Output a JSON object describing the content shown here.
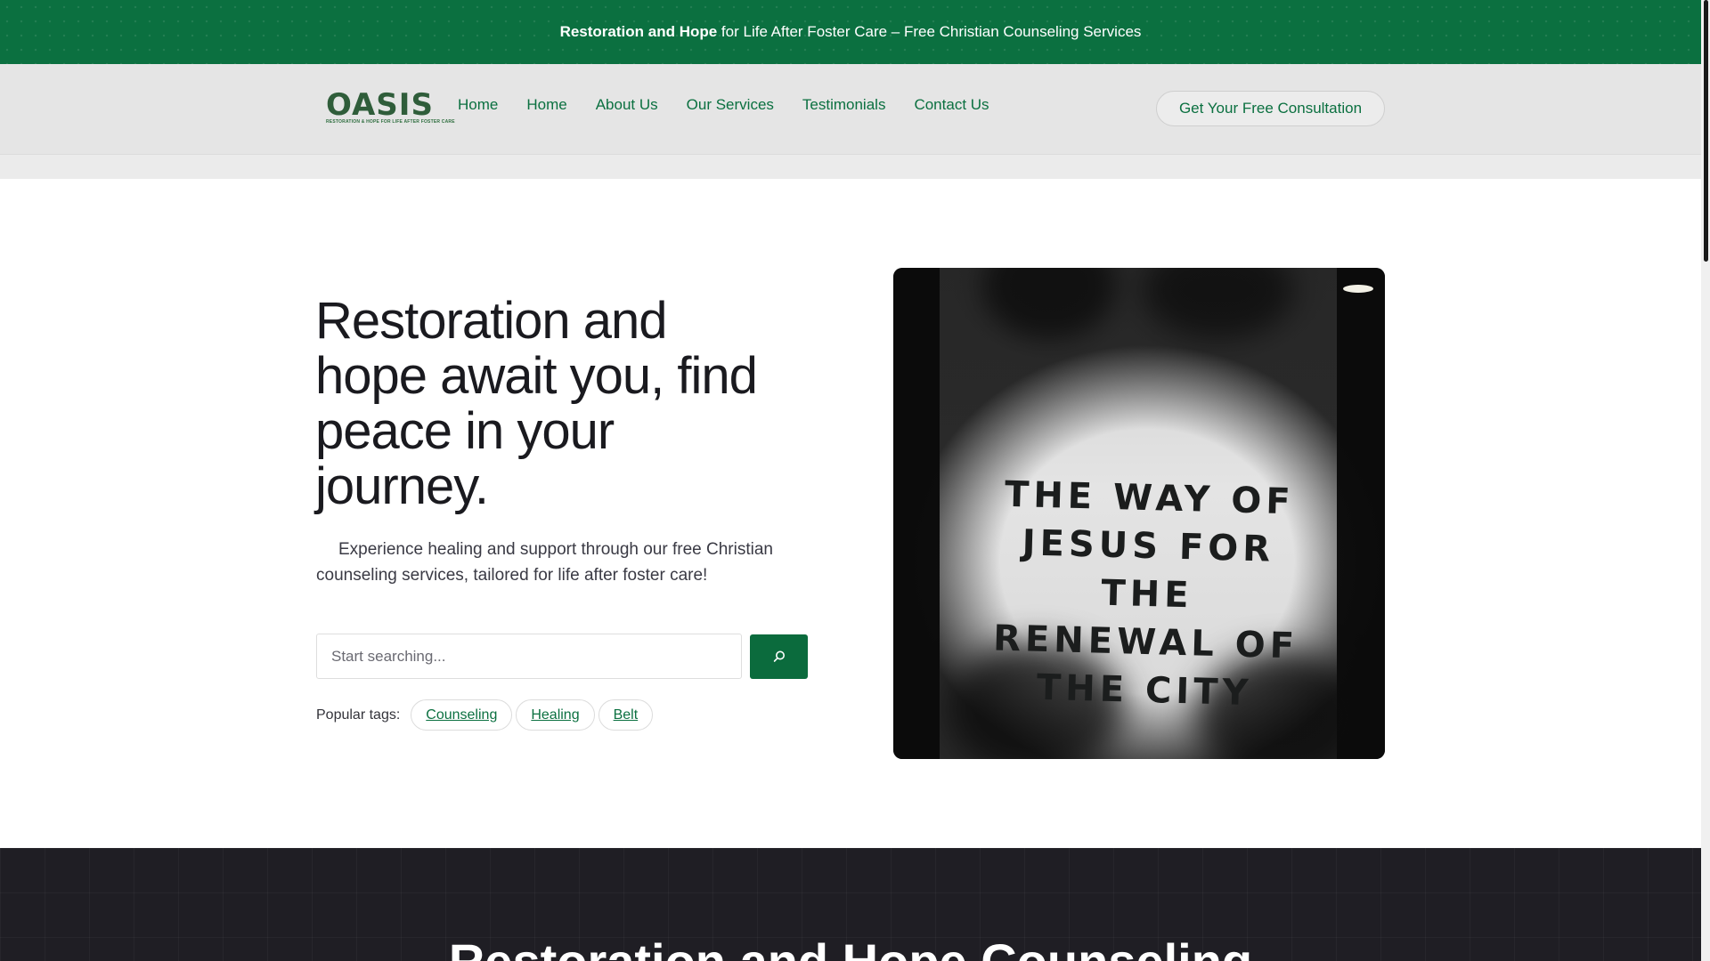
{
  "announcement": {
    "bold": "Restoration and Hope",
    "rest": " for Life After Foster Care – Free Christian Counseling Services"
  },
  "logo": {
    "word": "OASIS",
    "tagline": "RESTORATION & HOPE FOR LIFE AFTER FOSTER CARE"
  },
  "nav": {
    "items": [
      "Home",
      "Home",
      "About Us",
      "Our Services",
      "Testimonials",
      "Contact Us"
    ],
    "cta": "Get Your Free Consultation"
  },
  "hero": {
    "title": "Restoration and hope await you, find peace in your journey.",
    "subtitle": "Experience healing and support through our free Christian counseling services, tailored for life after foster care!",
    "search_placeholder": "Start searching...",
    "tags_label": "Popular tags:",
    "tags": [
      "Counseling",
      "Healing",
      "Belt"
    ],
    "image_text": "THE WAY OF JESUS FOR THE RENEWAL OF THE CITY"
  },
  "section": {
    "title": "Restoration and Hope Counseling"
  },
  "colors": {
    "brand_green": "#0b7040",
    "dark_bg": "#1f1e24"
  }
}
